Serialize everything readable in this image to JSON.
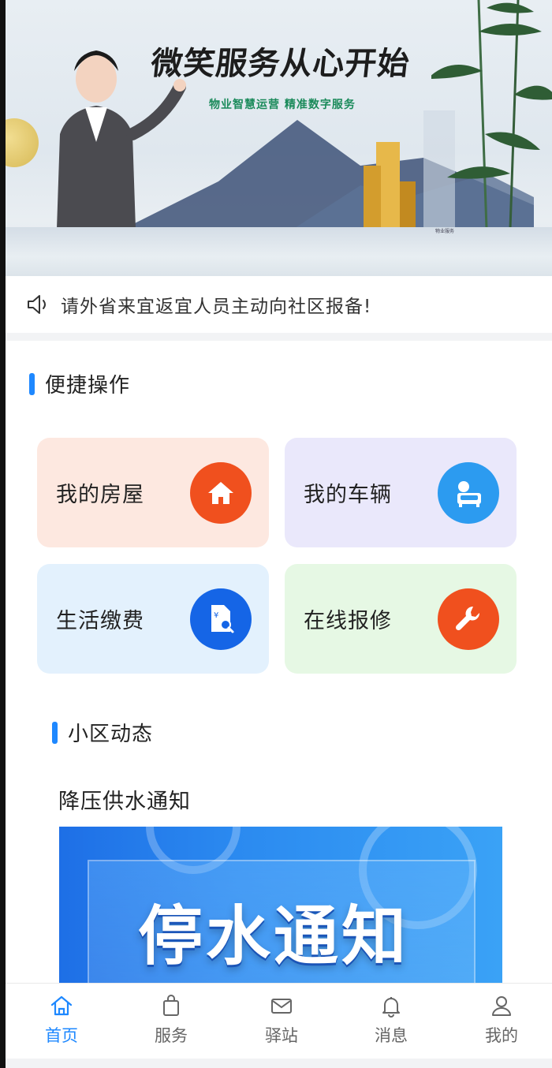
{
  "banner": {
    "title": "微笑服务从心开始",
    "subtitle": "物业智慧运营 精准数字服务",
    "corner_text": "物业服务"
  },
  "notice": {
    "icon": "speaker-icon",
    "text": "请外省来宜返宜人员主动向社区报备!"
  },
  "quick_actions": {
    "title": "便捷操作",
    "items": [
      {
        "label": "我的房屋",
        "icon": "house-icon",
        "bg": "#fde8e0",
        "icon_bg": "#f0501e"
      },
      {
        "label": "我的车辆",
        "icon": "vehicle-icon",
        "bg": "#eae8fb",
        "icon_bg": "#2c9bf0"
      },
      {
        "label": "生活缴费",
        "icon": "bill-search-icon",
        "bg": "#e3f1fd",
        "icon_bg": "#1565e6"
      },
      {
        "label": "在线报修",
        "icon": "wrench-icon",
        "bg": "#e6f8e4",
        "icon_bg": "#f0501e"
      }
    ]
  },
  "community": {
    "title": "小区动态",
    "news": [
      {
        "title": "降压供水通知",
        "image_text": "停水通知"
      }
    ]
  },
  "tabbar": {
    "items": [
      {
        "label": "首页",
        "icon": "home-icon",
        "active": true
      },
      {
        "label": "服务",
        "icon": "bag-icon",
        "active": false
      },
      {
        "label": "驿站",
        "icon": "mail-icon",
        "active": false
      },
      {
        "label": "消息",
        "icon": "bell-icon",
        "active": false
      },
      {
        "label": "我的",
        "icon": "user-icon",
        "active": false
      }
    ],
    "active_color": "#1e88ff",
    "inactive_color": "#666666"
  },
  "accent_color": "#1e88ff"
}
